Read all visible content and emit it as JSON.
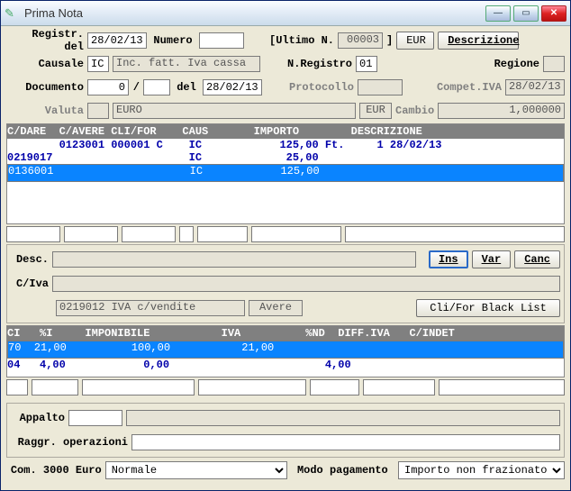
{
  "window": {
    "title": "Prima Nota"
  },
  "labels": {
    "registr_del": "Registr. del",
    "numero": "Numero",
    "ultimo_n": "[Ultimo N.",
    "eur": "EUR",
    "descrizione": "Descrizione",
    "causale": "Causale",
    "nregistro": "N.Registro",
    "regione": "Regione",
    "documento": "Documento",
    "slash": "/",
    "del": "del",
    "protocollo": "Protocollo",
    "compet_iva": "Compet.IVA",
    "valuta": "Valuta",
    "cambio": "Cambio",
    "desc": "Desc.",
    "civa": "C/Iva",
    "ins": "Ins",
    "var": "Var",
    "canc": "Canc",
    "clifor_blacklist": "Cli/For Black List",
    "appalto": "Appalto",
    "raggr": "Raggr. operazioni",
    "com3000": "Com. 3000 Euro",
    "modo_pag": "Modo pagamento",
    "avere_lbl": "Avere"
  },
  "fields": {
    "registr_del": "28/02/13",
    "numero": "",
    "ultimo_n": "00003",
    "ultimo_n_suffix": "]",
    "causale_code": "IC",
    "causale_desc": "Inc. fatt. Iva cassa",
    "nregistro": "01",
    "regione": "",
    "documento_a": "0",
    "documento_b": "",
    "del": "28/02/13",
    "protocollo": "",
    "compet_iva": "28/02/13",
    "valuta_name": "EURO",
    "valuta_code": "EUR",
    "cambio": "   1,000000",
    "civa_line": "0219012  IVA c/vendite",
    "appalto": "",
    "raggr": "",
    "com3000": "Normale",
    "modo_pag": "Importo non frazionato"
  },
  "grid1": {
    "header": "C/DARE  C/AVERE CLI/FOR    CAUS       IMPORTO        DESCRIZIONE",
    "rows": [
      {
        "text": "        0123001 000001 C    IC            125,00 Ft.     1 28/02/13",
        "style": "blue"
      },
      {
        "text": "0219017                     IC             25,00",
        "style": "blue"
      },
      {
        "text": "0136001                     IC            125,00",
        "style": "sel"
      }
    ]
  },
  "grid2": {
    "header": "CI   %I     IMPONIBILE           IVA          %ND  DIFF.IVA   C/INDET",
    "rows": [
      {
        "text": "70  21,00          100,00           21,00",
        "style": "sel"
      },
      {
        "text": "04   4,00            0,00                        4,00",
        "style": "blue"
      }
    ]
  },
  "chart_data": {
    "type": "table",
    "entries": [
      {
        "cdare": "",
        "cavere": "0123001",
        "clifor": "000001",
        "tipo": "C",
        "caus": "IC",
        "importo": 125.0,
        "descrizione": "Ft.     1 28/02/13"
      },
      {
        "cdare": "0219017",
        "cavere": "",
        "clifor": "",
        "tipo": "",
        "caus": "IC",
        "importo": 25.0,
        "descrizione": ""
      },
      {
        "cdare": "0136001",
        "cavere": "",
        "clifor": "",
        "tipo": "",
        "caus": "IC",
        "importo": 125.0,
        "descrizione": ""
      }
    ],
    "iva_rows": [
      {
        "ci": "70",
        "pct": 21.0,
        "imponibile": 100.0,
        "iva": 21.0,
        "pct_nd": null,
        "diff_iva": null,
        "c_indet": null
      },
      {
        "ci": "04",
        "pct": 4.0,
        "imponibile": 0.0,
        "iva": null,
        "pct_nd": null,
        "diff_iva": 4.0,
        "c_indet": null
      }
    ]
  }
}
